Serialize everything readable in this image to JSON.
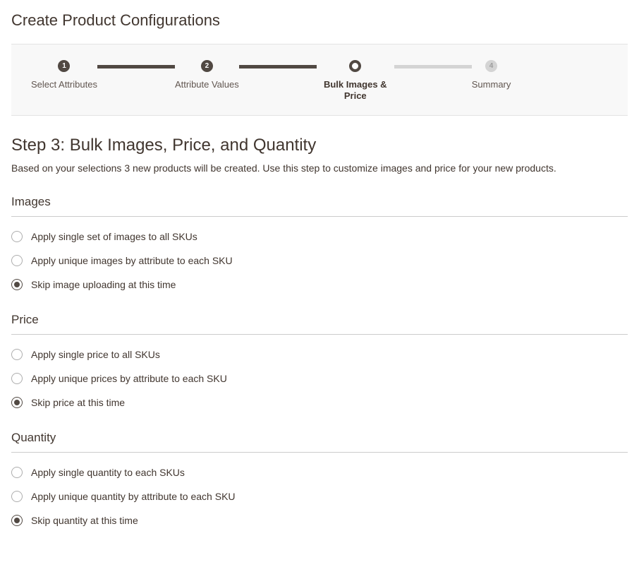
{
  "page_title": "Create Product Configurations",
  "stepper": {
    "steps": [
      {
        "num": "1",
        "label": "Select Attributes",
        "state": "done"
      },
      {
        "num": "2",
        "label": "Attribute Values",
        "state": "done"
      },
      {
        "num": "",
        "label": "Bulk Images & Price",
        "state": "current"
      },
      {
        "num": "4",
        "label": "Summary",
        "state": "future"
      }
    ]
  },
  "step": {
    "heading": "Step 3: Bulk Images, Price, and Quantity",
    "description": "Based on your selections 3 new products will be created. Use this step to customize images and price for your new products."
  },
  "sections": {
    "images": {
      "title": "Images",
      "options": [
        {
          "label": "Apply single set of images to all SKUs",
          "checked": false
        },
        {
          "label": "Apply unique images by attribute to each SKU",
          "checked": false
        },
        {
          "label": "Skip image uploading at this time",
          "checked": true
        }
      ]
    },
    "price": {
      "title": "Price",
      "options": [
        {
          "label": "Apply single price to all SKUs",
          "checked": false
        },
        {
          "label": "Apply unique prices by attribute to each SKU",
          "checked": false
        },
        {
          "label": "Skip price at this time",
          "checked": true
        }
      ]
    },
    "quantity": {
      "title": "Quantity",
      "options": [
        {
          "label": "Apply single quantity to each SKUs",
          "checked": false
        },
        {
          "label": "Apply unique quantity by attribute to each SKU",
          "checked": false
        },
        {
          "label": "Skip quantity at this time",
          "checked": true
        }
      ]
    }
  }
}
